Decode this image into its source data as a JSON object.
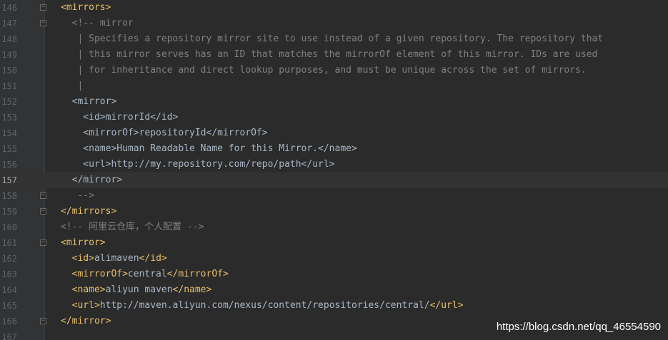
{
  "editor": {
    "lines": [
      {
        "num": "146",
        "fold": true,
        "segments": [
          {
            "t": "tag",
            "v": "<mirrors>"
          }
        ]
      },
      {
        "num": "147",
        "fold": true,
        "segments": [
          {
            "t": "comment",
            "v": "  <!-- mirror"
          }
        ]
      },
      {
        "num": "148",
        "fold": false,
        "segments": [
          {
            "t": "comment",
            "v": "   | Specifies a repository mirror site to use instead of a given repository. The repository that"
          }
        ]
      },
      {
        "num": "149",
        "fold": false,
        "segments": [
          {
            "t": "comment",
            "v": "   | this mirror serves has an ID that matches the mirrorOf element of this mirror. IDs are used"
          }
        ]
      },
      {
        "num": "150",
        "fold": false,
        "segments": [
          {
            "t": "comment",
            "v": "   | for inheritance and direct lookup purposes, and must be unique across the set of mirrors."
          }
        ]
      },
      {
        "num": "151",
        "fold": false,
        "segments": [
          {
            "t": "comment",
            "v": "   |"
          }
        ]
      },
      {
        "num": "152",
        "fold": false,
        "segments": [
          {
            "t": "dim",
            "v": "  <mirror>"
          }
        ]
      },
      {
        "num": "153",
        "fold": false,
        "segments": [
          {
            "t": "dim",
            "v": "    <id>mirrorId</id>"
          }
        ]
      },
      {
        "num": "154",
        "fold": false,
        "segments": [
          {
            "t": "dim",
            "v": "    <mirrorOf>repositoryId</mirrorOf>"
          }
        ]
      },
      {
        "num": "155",
        "fold": false,
        "segments": [
          {
            "t": "dim",
            "v": "    <name>Human Readable Name for this Mirror.</name>"
          }
        ]
      },
      {
        "num": "156",
        "fold": false,
        "segments": [
          {
            "t": "dim",
            "v": "    <url>http://my.repository.com/repo/path</url>"
          }
        ]
      },
      {
        "num": "157",
        "fold": false,
        "current": true,
        "segments": [
          {
            "t": "dim",
            "v": "  </mirror>"
          }
        ]
      },
      {
        "num": "158",
        "fold": true,
        "segments": [
          {
            "t": "comment",
            "v": "   -->"
          }
        ]
      },
      {
        "num": "159",
        "fold": true,
        "segments": [
          {
            "t": "tag",
            "v": "</mirrors>"
          }
        ]
      },
      {
        "num": "160",
        "fold": false,
        "segments": [
          {
            "t": "comment",
            "v": "<!-- 阿里云仓库，个人配置 -->"
          }
        ]
      },
      {
        "num": "161",
        "fold": true,
        "segments": [
          {
            "t": "tag",
            "v": "<mirror>"
          }
        ]
      },
      {
        "num": "162",
        "fold": false,
        "segments": [
          {
            "t": "tag",
            "v": "  <id>"
          },
          {
            "t": "text",
            "v": "alimaven"
          },
          {
            "t": "tag",
            "v": "</id>"
          }
        ]
      },
      {
        "num": "163",
        "fold": false,
        "segments": [
          {
            "t": "tag",
            "v": "  <mirrorOf>"
          },
          {
            "t": "text",
            "v": "central"
          },
          {
            "t": "tag",
            "v": "</mirrorOf>"
          }
        ]
      },
      {
        "num": "164",
        "fold": false,
        "segments": [
          {
            "t": "tag",
            "v": "  <name>"
          },
          {
            "t": "text",
            "v": "aliyun maven"
          },
          {
            "t": "tag",
            "v": "</name>"
          }
        ]
      },
      {
        "num": "165",
        "fold": false,
        "segments": [
          {
            "t": "tag",
            "v": "  <url>"
          },
          {
            "t": "text",
            "v": "http://maven.aliyun.com/nexus/content/repositories/central/"
          },
          {
            "t": "tag",
            "v": "</url>"
          }
        ]
      },
      {
        "num": "166",
        "fold": true,
        "segments": [
          {
            "t": "tag",
            "v": "</mirror>"
          }
        ]
      },
      {
        "num": "167",
        "fold": false,
        "segments": []
      }
    ]
  },
  "watermark": "https://blog.csdn.net/qq_46554590",
  "colors": {
    "background": "#2b2b2b",
    "gutter": "#313335",
    "tag": "#e8bf6a",
    "text": "#a9b7c6",
    "comment": "#808080",
    "current_line": "#323232"
  }
}
